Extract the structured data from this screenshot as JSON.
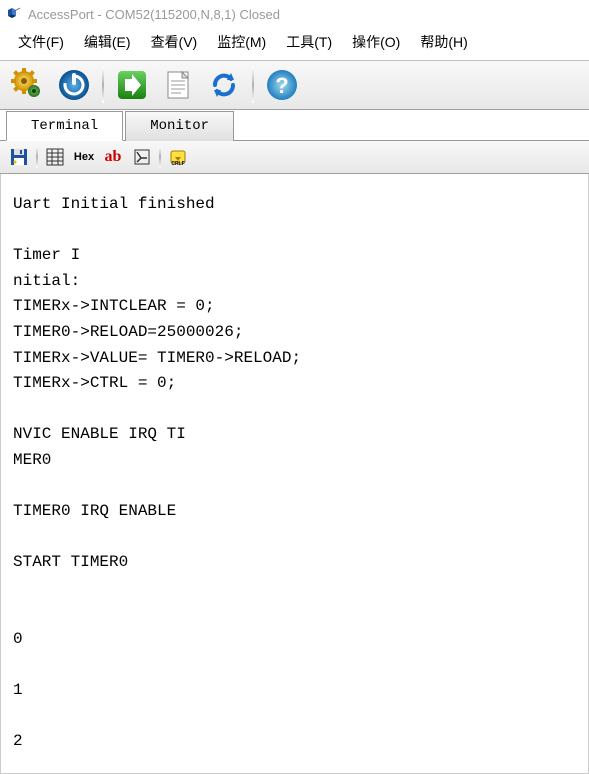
{
  "titlebar": {
    "text": "AccessPort - COM52(115200,N,8,1) Closed"
  },
  "menu": {
    "file": "文件(F)",
    "edit": "编辑(E)",
    "view": "查看(V)",
    "monitor": "监控(M)",
    "tools": "工具(T)",
    "operation": "操作(O)",
    "help": "帮助(H)"
  },
  "tabs": {
    "terminal": "Terminal",
    "monitor": "Monitor"
  },
  "subtoolbar": {
    "hex": "Hex",
    "ab": "ab"
  },
  "terminal_output": "Uart Initial finished\n\nTimer I\nnitial:\nTIMERx->INTCLEAR = 0;\nTIMER0->RELOAD=25000026;\nTIMERx->VALUE= TIMER0->RELOAD;\nTIMERx->CTRL = 0;\n\nNVIC ENABLE IRQ TI\nMER0\n\nTIMER0 IRQ ENABLE\n\nSTART TIMER0\n\n\n0\n\n1\n\n2"
}
